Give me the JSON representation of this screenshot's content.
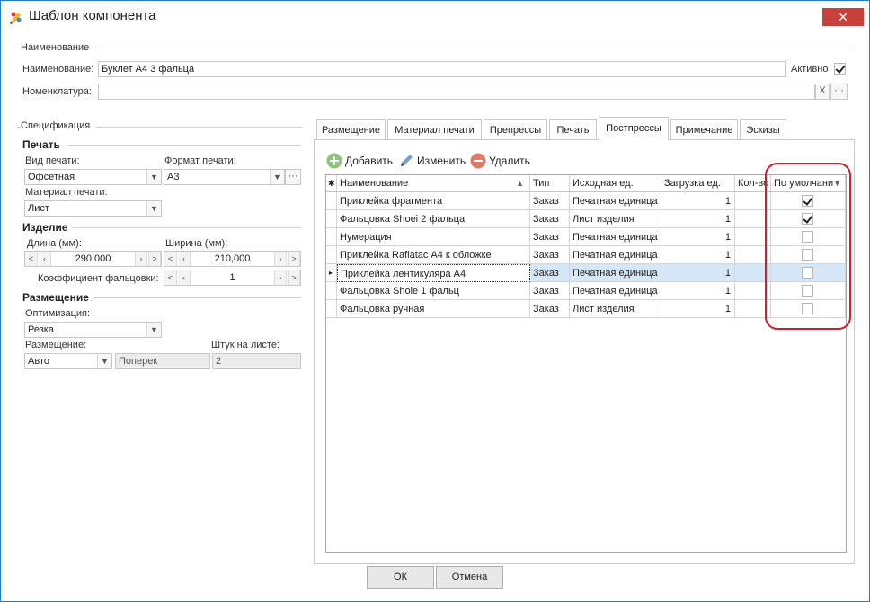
{
  "window": {
    "title": "Шаблон компонента",
    "close_glyph": "✕"
  },
  "naming_group": {
    "title": "Наименование",
    "name_label": "Наименование:",
    "name_value": "Буклет А4 3 фальца",
    "active_label": "Активно",
    "active_checked": true,
    "nomenclature_label": "Номенклатура:",
    "nomenclature_value": "",
    "clear_glyph": "X",
    "ellipsis": "···"
  },
  "spec": {
    "title": "Спецификация",
    "print_section": "Печать",
    "print_type_label": "Вид печати:",
    "print_type_value": "Офсетная",
    "print_format_label": "Формат печати:",
    "print_format_value": "А3",
    "print_material_label": "Материал печати:",
    "print_material_value": "Лист",
    "product_section": "Изделие",
    "length_label": "Длина (мм):",
    "length_value": "290,000",
    "width_label": "Ширина (мм):",
    "width_value": "210,000",
    "fold_coef_label": "Коэффициент фальцовки:",
    "fold_coef_value": "1",
    "placement_section": "Размещение",
    "optimization_label": "Оптимизация:",
    "optimization_value": "Резка",
    "placement_label": "Размещение:",
    "placement_value": "Авто",
    "orientation_value": "Поперек",
    "per_sheet_label": "Штук на листе:",
    "per_sheet_value": "2"
  },
  "tabs": [
    {
      "label": "Размещение"
    },
    {
      "label": "Материал печати"
    },
    {
      "label": "Препрессы"
    },
    {
      "label": "Печать"
    },
    {
      "label": "Постпрессы"
    },
    {
      "label": "Примечание"
    },
    {
      "label": "Эскизы"
    }
  ],
  "active_tab": "Постпрессы",
  "toolbar": {
    "add": "Добавить",
    "edit": "Изменить",
    "delete": "Удалить"
  },
  "grid": {
    "columns": [
      "Наименование",
      "Тип",
      "Исходная ед.",
      "Загрузка ед.",
      "Кол-во",
      "По умолчани"
    ],
    "rows": [
      {
        "name": "Приклейка фрагмента",
        "type": "Заказ",
        "unit": "Печатная единица",
        "load": "1",
        "default": true
      },
      {
        "name": "Фальцовка Shoei 2 фальца",
        "type": "Заказ",
        "unit": "Лист изделия",
        "load": "1",
        "default": true
      },
      {
        "name": "Нумерация",
        "type": "Заказ",
        "unit": "Печатная единица",
        "load": "1",
        "default": false
      },
      {
        "name": "Приклейка Raflatac А4 к обложке",
        "type": "Заказ",
        "unit": "Печатная единица",
        "load": "1",
        "default": false
      },
      {
        "name": "Приклейка лентикуляра А4",
        "type": "Заказ",
        "unit": "Печатная единица",
        "load": "1",
        "default": false
      },
      {
        "name": "Фальцовка Shoie 1 фальц",
        "type": "Заказ",
        "unit": "Печатная единица",
        "load": "1",
        "default": false
      },
      {
        "name": "Фальцовка ручная",
        "type": "Заказ",
        "unit": "Лист изделия",
        "load": "1",
        "default": false
      }
    ],
    "selected_row": 4
  },
  "buttons": {
    "ok": "ОК",
    "cancel": "Отмена"
  },
  "colors": {
    "accent": "#1f7dcc",
    "highlight": "#d01e2a",
    "selection": "#d6e8f7"
  }
}
